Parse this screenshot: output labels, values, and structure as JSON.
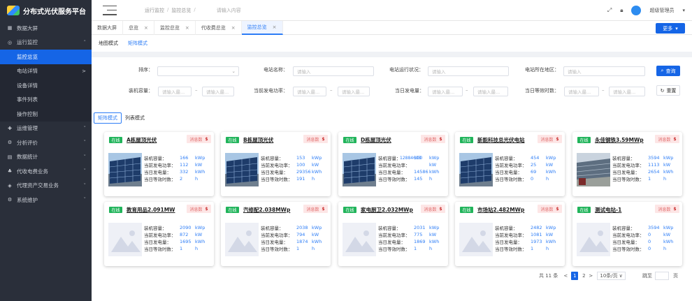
{
  "app": {
    "title": "分布式光伏服务平台"
  },
  "sidebar": {
    "items": [
      {
        "label": "数据大屏",
        "icon": "grid-icon",
        "caret": ""
      },
      {
        "label": "运行监控",
        "icon": "monitor-icon",
        "caret": "˄"
      },
      {
        "label": "运维管理",
        "icon": "wrench-icon",
        "caret": "˅"
      },
      {
        "label": "分析评价",
        "icon": "analysis-icon",
        "caret": "˅"
      },
      {
        "label": "数据统计",
        "icon": "stats-icon",
        "caret": "˅"
      },
      {
        "label": "代收电费业务",
        "icon": "fee-icon",
        "caret": "˅"
      },
      {
        "label": "代理资产交易业务",
        "icon": "trade-icon",
        "caret": "˅"
      },
      {
        "label": "系统维护",
        "icon": "system-icon",
        "caret": "˅"
      }
    ],
    "sub_items": [
      {
        "label": "监控总览",
        "caret": ""
      },
      {
        "label": "电站详情",
        "caret": ">"
      },
      {
        "label": "设备详情",
        "caret": ""
      },
      {
        "label": "事件列表",
        "caret": ""
      },
      {
        "label": "操作控制",
        "caret": ""
      }
    ]
  },
  "header": {
    "breadcrumb": [
      "运行监控",
      "监控总览"
    ],
    "breadcrumb_sep": "/",
    "search_placeholder": "请输入内容",
    "user": "超级管理员",
    "user_caret": "▾"
  },
  "tabs": [
    {
      "label": "数据大屏",
      "closable": false
    },
    {
      "label": "总览",
      "closable": true
    },
    {
      "label": "监控总览",
      "closable": true
    },
    {
      "label": "代收费总览",
      "closable": true
    },
    {
      "label": "监控总览",
      "closable": true
    }
  ],
  "tab_close": "×",
  "more_button": "更多",
  "more_caret": "▾",
  "mode_tabs": [
    "地图模式",
    "矩阵模式"
  ],
  "filters": {
    "sort_label": "排序：",
    "sort_value": "",
    "station_name_label": "电站名称：",
    "station_status_label": "电站运行状况：",
    "station_region_label": "电站所在地区：",
    "input_placeholder": "请输入",
    "capacity_label": "装机容量：",
    "power_label": "当前发电功率：",
    "daily_energy_label": "当日发电量：",
    "hours_label": "当日等效时数：",
    "range_placeholder": "请输入最...",
    "range_sep": "–",
    "search_btn": "查询",
    "reset_btn": "重置"
  },
  "view_tabs": [
    "矩阵模式",
    "列表模式"
  ],
  "card_labels": {
    "online": "在线",
    "consume": "消息数",
    "consume_icon": "$",
    "capacity": "装机容量：",
    "power": "当前发电功率：",
    "energy": "当日发电量：",
    "hours": "当日等效时数：",
    "u_capacity": "kWp",
    "u_power": "kW",
    "u_energy": "kWh",
    "u_hours": "h"
  },
  "stations": [
    {
      "name": "A栋屋顶光伏",
      "capacity": "166",
      "power": "112",
      "energy": "332",
      "hours": "2",
      "image": "solar-panel",
      "overflow": ""
    },
    {
      "name": "B栋屋顶光伏",
      "capacity": "153",
      "power": "100",
      "energy": "29356",
      "hours": "191",
      "image": "solar-panel",
      "overflow": ""
    },
    {
      "name": "D栋屋顶光伏",
      "capacity": "100",
      "power": "",
      "energy": "14586",
      "hours": "145",
      "image": "solar-panel",
      "overflow": "12884603"
    },
    {
      "name": "新能科技总光伏电站",
      "capacity": "454",
      "power": "25",
      "energy": "69",
      "hours": "0",
      "image": "solar-panel",
      "overflow": ""
    },
    {
      "name": "永佳钢铁3.59MWp",
      "capacity": "3594",
      "power": "1113",
      "energy": "2654",
      "hours": "1",
      "image": "rooftop",
      "overflow": ""
    },
    {
      "name": "教育用品2.091MW",
      "capacity": "2090",
      "power": "872",
      "energy": "1695",
      "hours": "1",
      "image": "placeholder",
      "overflow": ""
    },
    {
      "name": "汽修配2.038MWp",
      "capacity": "2038",
      "power": "794",
      "energy": "1874",
      "hours": "1",
      "image": "placeholder",
      "overflow": ""
    },
    {
      "name": "家电厨卫2.032MWp",
      "capacity": "2031",
      "power": "775",
      "energy": "1869",
      "hours": "1",
      "image": "placeholder",
      "overflow": ""
    },
    {
      "name": "市场站2.482MWp",
      "capacity": "2482",
      "power": "1081",
      "energy": "1973",
      "hours": "1",
      "image": "placeholder",
      "overflow": ""
    },
    {
      "name": "测试电站-1",
      "capacity": "3594",
      "power": "0",
      "energy": "0",
      "hours": "0",
      "image": "placeholder",
      "overflow": ""
    }
  ],
  "pagination": {
    "total": "共 11 条",
    "prev": "<",
    "pages": [
      "1",
      "2"
    ],
    "next": ">",
    "page_size": "10条/页",
    "size_caret": "∨",
    "goto": "跳至",
    "page_unit": "页"
  }
}
